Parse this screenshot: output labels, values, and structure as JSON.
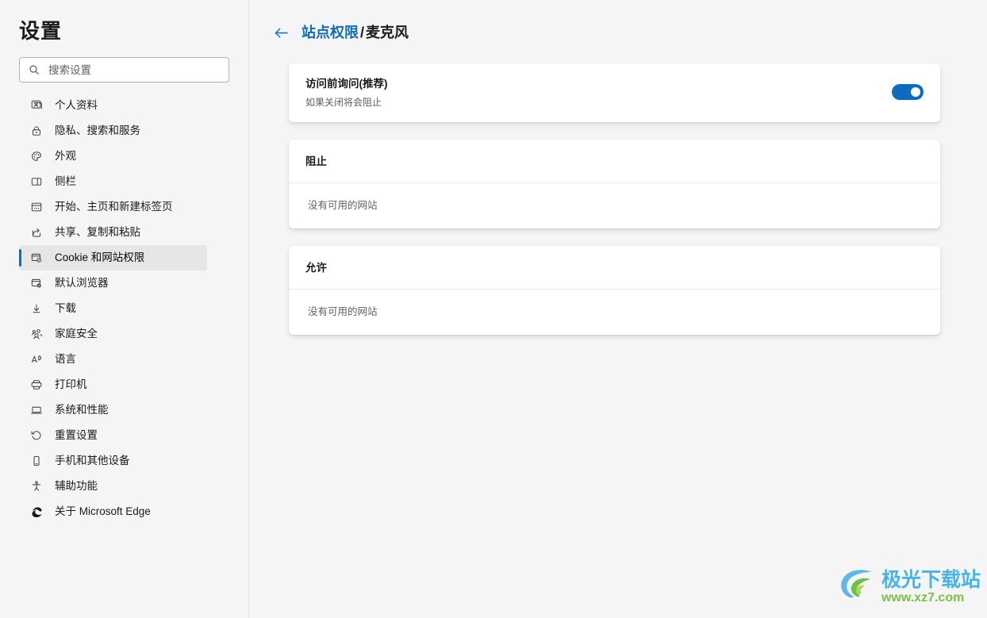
{
  "sidebar": {
    "title": "设置",
    "search": {
      "placeholder": "搜索设置",
      "value": "",
      "icon": "search-icon"
    },
    "items": [
      {
        "label": "个人资料",
        "icon": "profile-card-icon",
        "selected": false
      },
      {
        "label": "隐私、搜索和服务",
        "icon": "lock-icon",
        "selected": false
      },
      {
        "label": "外观",
        "icon": "palette-icon",
        "selected": false
      },
      {
        "label": "侧栏",
        "icon": "sidebar-panel-icon",
        "selected": false
      },
      {
        "label": "开始、主页和新建标签页",
        "icon": "browser-window-icon",
        "selected": false
      },
      {
        "label": "共享、复制和粘贴",
        "icon": "share-icon",
        "selected": false
      },
      {
        "label": "Cookie 和网站权限",
        "icon": "cookie-settings-icon",
        "selected": true
      },
      {
        "label": "默认浏览器",
        "icon": "browser-check-icon",
        "selected": false
      },
      {
        "label": "下载",
        "icon": "download-arrow-icon",
        "selected": false
      },
      {
        "label": "家庭安全",
        "icon": "family-people-icon",
        "selected": false
      },
      {
        "label": "语言",
        "icon": "language-a-icon",
        "selected": false
      },
      {
        "label": "打印机",
        "icon": "printer-icon",
        "selected": false
      },
      {
        "label": "系统和性能",
        "icon": "laptop-icon",
        "selected": false
      },
      {
        "label": "重置设置",
        "icon": "reset-arrow-icon",
        "selected": false
      },
      {
        "label": "手机和其他设备",
        "icon": "phone-icon",
        "selected": false
      },
      {
        "label": "辅助功能",
        "icon": "accessibility-icon",
        "selected": false
      },
      {
        "label": "关于 Microsoft Edge",
        "icon": "edge-logo-icon",
        "selected": false
      }
    ]
  },
  "header": {
    "back_icon": "back-arrow-icon",
    "breadcrumb_parent": "站点权限",
    "breadcrumb_separator": "/",
    "breadcrumb_current": "麦克风"
  },
  "main": {
    "ask_card": {
      "title": "访问前询问(推荐)",
      "subtitle": "如果关闭将会阻止",
      "toggle_on": true
    },
    "block_card": {
      "title": "阻止",
      "empty_text": "没有可用的网站"
    },
    "allow_card": {
      "title": "允许",
      "empty_text": "没有可用的网站"
    }
  },
  "watermark": {
    "title": "极光下载站",
    "url": "www.xz7.com"
  },
  "colors": {
    "accent_blue": "#0f6cbd",
    "page_bg": "#f5f5f5",
    "card_bg": "#ffffff",
    "selected_bg": "#e6e6e6",
    "muted_text": "#616161",
    "watermark_blue": "#44b4ea",
    "watermark_green": "#7ac143"
  }
}
